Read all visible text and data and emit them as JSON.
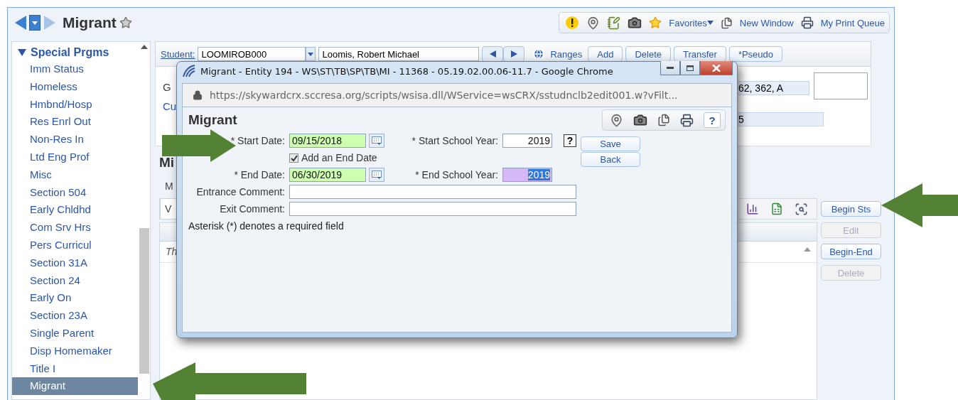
{
  "header": {
    "title": "Migrant",
    "links": [
      {
        "kind": "favorites",
        "label": "Favorites"
      },
      {
        "kind": "new_window",
        "label": "New Window"
      },
      {
        "kind": "print_queue",
        "label": "My Print Queue"
      }
    ]
  },
  "sidebar": {
    "group": "Special Prgms",
    "expanded": true,
    "items": [
      {
        "label": "Imm Status",
        "selected": false
      },
      {
        "label": "Homeless",
        "selected": false
      },
      {
        "label": "Hmbnd/Hosp",
        "selected": false
      },
      {
        "label": "Res Enrl Out",
        "selected": false
      },
      {
        "label": "Non-Res In",
        "selected": false
      },
      {
        "label": "Ltd Eng Prof",
        "selected": false
      },
      {
        "label": "Misc",
        "selected": false
      },
      {
        "label": "Section 504",
        "selected": false
      },
      {
        "label": "Early Chldhd",
        "selected": false
      },
      {
        "label": "Com Srv Hrs",
        "selected": false
      },
      {
        "label": "Pers Curricul",
        "selected": false
      },
      {
        "label": "Section 31A",
        "selected": false
      },
      {
        "label": "Section 24",
        "selected": false
      },
      {
        "label": "Early On",
        "selected": false
      },
      {
        "label": "Section 23A",
        "selected": false
      },
      {
        "label": "Single Parent",
        "selected": false
      },
      {
        "label": "Disp Homemaker",
        "selected": false
      },
      {
        "label": "Title I",
        "selected": false
      },
      {
        "label": "Migrant",
        "selected": true
      }
    ]
  },
  "student_bar": {
    "label": "Student:",
    "student_id": "LOOMIROB000",
    "student_name": "Loomis, Robert Michael",
    "buttons": [
      {
        "kind": "link",
        "label": "Ranges"
      },
      {
        "kind": "button",
        "label": "Add"
      },
      {
        "kind": "button",
        "label": "Delete"
      },
      {
        "kind": "button",
        "label": "Transfer"
      },
      {
        "kind": "button",
        "label": "*Pseudo"
      }
    ]
  },
  "record_panel": {
    "column_1": [
      "G",
      "Cu"
    ],
    "field_1": "62, 362, A",
    "field_2": "5"
  },
  "section": {
    "heading": "Mi",
    "tab": "M",
    "button": "V",
    "grid_row": "Th"
  },
  "side_buttons": [
    {
      "label": "Begin Sts",
      "disabled": false
    },
    {
      "label": "Edit",
      "disabled": true
    },
    {
      "label": "Begin-End",
      "disabled": false
    },
    {
      "label": "Delete",
      "disabled": true
    }
  ],
  "popup": {
    "title": "Migrant - Entity 194 - WS\\ST\\TB\\SP\\TB\\MI - 11368 - 05.19.02.00.06-11.7 - Google Chrome",
    "url": "https://skywardcrx.sccresa.org/scripts/wsisa.dll/WService=wsCRX/sstudnclb2edit001.w?vFilt...",
    "heading": "Migrant",
    "toolbar_help": "?",
    "dates": [
      {
        "date_label": "* Start Date:",
        "date_value": "09/15/2018",
        "year_label": "* Start School Year:",
        "year_value": "2019",
        "focused": false
      },
      {
        "date_label": "* End Date:",
        "date_value": "06/30/2019",
        "year_label": "* End School Year:",
        "year_value": "2019",
        "focused": true
      }
    ],
    "field_help": "?",
    "checkbox": {
      "label": "Add an End Date",
      "checked": true
    },
    "buttons": [
      "Save",
      "Back"
    ],
    "comments": [
      {
        "label": "Entrance Comment:"
      },
      {
        "label": "Exit Comment:"
      }
    ],
    "note": "Asterisk (*) denotes a required field"
  }
}
